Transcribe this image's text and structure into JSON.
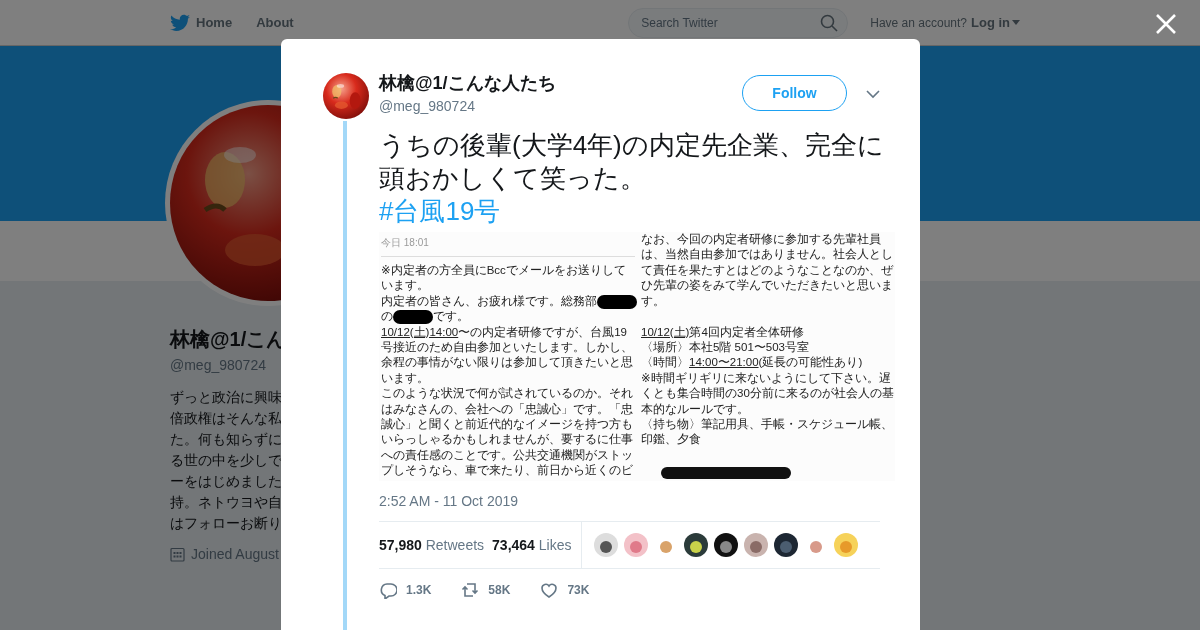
{
  "nav": {
    "items": [
      {
        "label": "Home",
        "kind": "home"
      },
      {
        "label": "About",
        "kind": "link"
      }
    ],
    "search": {
      "placeholder": "Search Twitter"
    },
    "account_prompt": "Have an account?",
    "login": "Log in"
  },
  "profile": {
    "name": "林檎@1/こん",
    "handle": "@meg_980724",
    "bio_lines": [
      "ずっと政治に興味",
      "倍政権はそんな私",
      "た。何も知らずに",
      "る世の中を少しで",
      "ーをはじめました",
      "持。ネトウヨや自",
      "はフォローお断り"
    ],
    "joined": "Joined August"
  },
  "tweet": {
    "name": "林檎@1/こんな人たち",
    "handle": "@meg_980724",
    "follow": "Follow",
    "text": "うちの後輩(大学4年)の内定先企業、完全に頭おかしくて笑った。",
    "hashtag": "#台風19号",
    "attachment": {
      "header": "今日 18:01",
      "columns": [
        [
          {
            "kind": "text",
            "segments": [
              {
                "kind": "text",
                "text": "※内定者の方全員にBccでメールをお送りして"
              }
            ]
          },
          {
            "kind": "text",
            "segments": [
              {
                "kind": "text",
                "text": "います。"
              }
            ]
          },
          {
            "kind": "text",
            "segments": [
              {
                "kind": "text",
                "text": "内定者の皆さん、お疲れ様です。総務部"
              },
              {
                "kind": "redaction"
              }
            ]
          },
          {
            "kind": "text",
            "segments": [
              {
                "kind": "text",
                "text": "の"
              },
              {
                "kind": "redaction"
              },
              {
                "kind": "text",
                "text": "です。"
              }
            ]
          },
          {
            "kind": "text",
            "segments": [
              {
                "kind": "underlined",
                "text": "10/12(土)14:00"
              },
              {
                "kind": "text",
                "text": "〜の内定者研修ですが、台風19"
              }
            ]
          },
          {
            "kind": "text",
            "segments": [
              {
                "kind": "text",
                "text": "号接近のため自由参加といたします。しかし、"
              }
            ]
          },
          {
            "kind": "text",
            "segments": [
              {
                "kind": "text",
                "text": "余程の事情がない限りは参加して頂きたいと思"
              }
            ]
          },
          {
            "kind": "text",
            "segments": [
              {
                "kind": "text",
                "text": "います。"
              }
            ]
          },
          {
            "kind": "text",
            "segments": [
              {
                "kind": "text",
                "text": "このような状況で何が試されているのか。それ"
              }
            ]
          },
          {
            "kind": "text",
            "segments": [
              {
                "kind": "text",
                "text": "はみなさんの、会社への「忠誠心」です。「忠"
              }
            ]
          },
          {
            "kind": "text",
            "segments": [
              {
                "kind": "text",
                "text": "誠心」と聞くと前近代的なイメージを持つ方も"
              }
            ]
          },
          {
            "kind": "text",
            "segments": [
              {
                "kind": "text",
                "text": "いらっしゃるかもしれませんが、要するに仕事"
              }
            ]
          },
          {
            "kind": "text",
            "segments": [
              {
                "kind": "text",
                "text": "への責任感のことです。公共交通機関がストッ"
              }
            ]
          },
          {
            "kind": "text",
            "segments": [
              {
                "kind": "text",
                "text": "プしそうなら、車で来たり、前日から近くのビ"
              }
            ]
          }
        ],
        [
          {
            "kind": "text",
            "segments": [
              {
                "kind": "text",
                "text": "なお、今回の内定者研修に参加する先輩社員"
              }
            ]
          },
          {
            "kind": "text",
            "segments": [
              {
                "kind": "text",
                "text": "は、当然自由参加ではありません。社会人とし"
              }
            ]
          },
          {
            "kind": "text",
            "segments": [
              {
                "kind": "text",
                "text": "て責任を果たすとはどのようなことなのか、ぜ"
              }
            ]
          },
          {
            "kind": "text",
            "segments": [
              {
                "kind": "text",
                "text": "ひ先輩の姿をみて学んでいただきたいと思いま"
              }
            ]
          },
          {
            "kind": "text",
            "segments": [
              {
                "kind": "text",
                "text": "す。"
              }
            ]
          },
          {
            "kind": "blank"
          },
          {
            "kind": "text",
            "segments": [
              {
                "kind": "underlined",
                "text": "10/12(土)"
              },
              {
                "kind": "text",
                "text": " 第4回内定者全体研修"
              }
            ]
          },
          {
            "kind": "text",
            "segments": [
              {
                "kind": "text",
                "text": "〈場所〉本社5階 501〜503号室"
              }
            ]
          },
          {
            "kind": "text",
            "segments": [
              {
                "kind": "text",
                "text": "〈時間〉"
              },
              {
                "kind": "underlined",
                "text": "14:00〜21:00"
              },
              {
                "kind": "text",
                "text": " (延長の可能性あり)"
              }
            ]
          },
          {
            "kind": "text",
            "segments": [
              {
                "kind": "text",
                "text": "※時間ギリギリに来ないようにして下さい。遅"
              }
            ]
          },
          {
            "kind": "text",
            "segments": [
              {
                "kind": "text",
                "text": "くとも集合時間の30分前に来るのが社会人の基"
              }
            ]
          },
          {
            "kind": "text",
            "segments": [
              {
                "kind": "text",
                "text": "本的なルールです。"
              }
            ]
          },
          {
            "kind": "text",
            "segments": [
              {
                "kind": "text",
                "text": "〈持ち物〉筆記用具、手帳・スケジュール帳、"
              }
            ]
          },
          {
            "kind": "text",
            "segments": [
              {
                "kind": "text",
                "text": "印鑑、夕食"
              }
            ]
          },
          {
            "kind": "blank"
          },
          {
            "kind": "redacted"
          }
        ]
      ]
    },
    "timestamp": "2:52 AM - 11 Oct 2019",
    "retweets": {
      "count": "57,980",
      "label": "Retweets"
    },
    "likes": {
      "count": "73,464",
      "label": "Likes"
    },
    "actions": [
      {
        "kind": "reply",
        "count": "1.3K"
      },
      {
        "kind": "retweet",
        "count": "58K"
      },
      {
        "kind": "like",
        "count": "73K"
      }
    ]
  }
}
